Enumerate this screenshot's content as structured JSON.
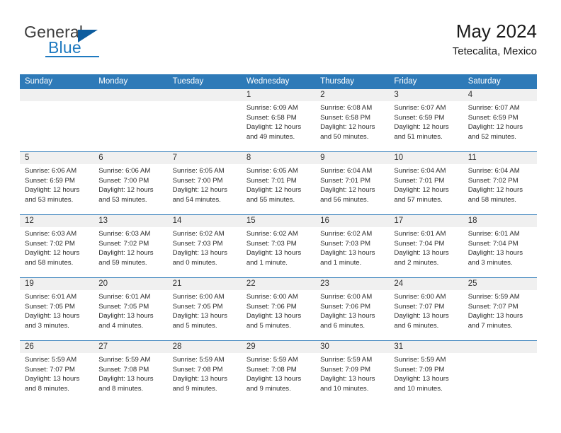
{
  "brand": {
    "word1": "General",
    "word2": "Blue",
    "logo_icon": "triangle-icon"
  },
  "header": {
    "title": "May 2024",
    "subtitle": "Tetecalita, Mexico"
  },
  "colors": {
    "header_blue": "#2e7ab8",
    "brand_blue": "#1f7ac0",
    "day_band_gray": "#f0f0f0"
  },
  "weekdays": [
    "Sunday",
    "Monday",
    "Tuesday",
    "Wednesday",
    "Thursday",
    "Friday",
    "Saturday"
  ],
  "labels": {
    "sunrise_prefix": "Sunrise:",
    "sunset_prefix": "Sunset:",
    "daylight_prefix": "Daylight:"
  },
  "weeks": [
    [
      {
        "day": "",
        "empty": true
      },
      {
        "day": "",
        "empty": true
      },
      {
        "day": "",
        "empty": true
      },
      {
        "day": "1",
        "sunrise": "Sunrise: 6:09 AM",
        "sunset": "Sunset: 6:58 PM",
        "daylight1": "Daylight: 12 hours",
        "daylight2": "and 49 minutes."
      },
      {
        "day": "2",
        "sunrise": "Sunrise: 6:08 AM",
        "sunset": "Sunset: 6:58 PM",
        "daylight1": "Daylight: 12 hours",
        "daylight2": "and 50 minutes."
      },
      {
        "day": "3",
        "sunrise": "Sunrise: 6:07 AM",
        "sunset": "Sunset: 6:59 PM",
        "daylight1": "Daylight: 12 hours",
        "daylight2": "and 51 minutes."
      },
      {
        "day": "4",
        "sunrise": "Sunrise: 6:07 AM",
        "sunset": "Sunset: 6:59 PM",
        "daylight1": "Daylight: 12 hours",
        "daylight2": "and 52 minutes."
      }
    ],
    [
      {
        "day": "5",
        "sunrise": "Sunrise: 6:06 AM",
        "sunset": "Sunset: 6:59 PM",
        "daylight1": "Daylight: 12 hours",
        "daylight2": "and 53 minutes."
      },
      {
        "day": "6",
        "sunrise": "Sunrise: 6:06 AM",
        "sunset": "Sunset: 7:00 PM",
        "daylight1": "Daylight: 12 hours",
        "daylight2": "and 53 minutes."
      },
      {
        "day": "7",
        "sunrise": "Sunrise: 6:05 AM",
        "sunset": "Sunset: 7:00 PM",
        "daylight1": "Daylight: 12 hours",
        "daylight2": "and 54 minutes."
      },
      {
        "day": "8",
        "sunrise": "Sunrise: 6:05 AM",
        "sunset": "Sunset: 7:01 PM",
        "daylight1": "Daylight: 12 hours",
        "daylight2": "and 55 minutes."
      },
      {
        "day": "9",
        "sunrise": "Sunrise: 6:04 AM",
        "sunset": "Sunset: 7:01 PM",
        "daylight1": "Daylight: 12 hours",
        "daylight2": "and 56 minutes."
      },
      {
        "day": "10",
        "sunrise": "Sunrise: 6:04 AM",
        "sunset": "Sunset: 7:01 PM",
        "daylight1": "Daylight: 12 hours",
        "daylight2": "and 57 minutes."
      },
      {
        "day": "11",
        "sunrise": "Sunrise: 6:04 AM",
        "sunset": "Sunset: 7:02 PM",
        "daylight1": "Daylight: 12 hours",
        "daylight2": "and 58 minutes."
      }
    ],
    [
      {
        "day": "12",
        "sunrise": "Sunrise: 6:03 AM",
        "sunset": "Sunset: 7:02 PM",
        "daylight1": "Daylight: 12 hours",
        "daylight2": "and 58 minutes."
      },
      {
        "day": "13",
        "sunrise": "Sunrise: 6:03 AM",
        "sunset": "Sunset: 7:02 PM",
        "daylight1": "Daylight: 12 hours",
        "daylight2": "and 59 minutes."
      },
      {
        "day": "14",
        "sunrise": "Sunrise: 6:02 AM",
        "sunset": "Sunset: 7:03 PM",
        "daylight1": "Daylight: 13 hours",
        "daylight2": "and 0 minutes."
      },
      {
        "day": "15",
        "sunrise": "Sunrise: 6:02 AM",
        "sunset": "Sunset: 7:03 PM",
        "daylight1": "Daylight: 13 hours",
        "daylight2": "and 1 minute."
      },
      {
        "day": "16",
        "sunrise": "Sunrise: 6:02 AM",
        "sunset": "Sunset: 7:03 PM",
        "daylight1": "Daylight: 13 hours",
        "daylight2": "and 1 minute."
      },
      {
        "day": "17",
        "sunrise": "Sunrise: 6:01 AM",
        "sunset": "Sunset: 7:04 PM",
        "daylight1": "Daylight: 13 hours",
        "daylight2": "and 2 minutes."
      },
      {
        "day": "18",
        "sunrise": "Sunrise: 6:01 AM",
        "sunset": "Sunset: 7:04 PM",
        "daylight1": "Daylight: 13 hours",
        "daylight2": "and 3 minutes."
      }
    ],
    [
      {
        "day": "19",
        "sunrise": "Sunrise: 6:01 AM",
        "sunset": "Sunset: 7:05 PM",
        "daylight1": "Daylight: 13 hours",
        "daylight2": "and 3 minutes."
      },
      {
        "day": "20",
        "sunrise": "Sunrise: 6:01 AM",
        "sunset": "Sunset: 7:05 PM",
        "daylight1": "Daylight: 13 hours",
        "daylight2": "and 4 minutes."
      },
      {
        "day": "21",
        "sunrise": "Sunrise: 6:00 AM",
        "sunset": "Sunset: 7:05 PM",
        "daylight1": "Daylight: 13 hours",
        "daylight2": "and 5 minutes."
      },
      {
        "day": "22",
        "sunrise": "Sunrise: 6:00 AM",
        "sunset": "Sunset: 7:06 PM",
        "daylight1": "Daylight: 13 hours",
        "daylight2": "and 5 minutes."
      },
      {
        "day": "23",
        "sunrise": "Sunrise: 6:00 AM",
        "sunset": "Sunset: 7:06 PM",
        "daylight1": "Daylight: 13 hours",
        "daylight2": "and 6 minutes."
      },
      {
        "day": "24",
        "sunrise": "Sunrise: 6:00 AM",
        "sunset": "Sunset: 7:07 PM",
        "daylight1": "Daylight: 13 hours",
        "daylight2": "and 6 minutes."
      },
      {
        "day": "25",
        "sunrise": "Sunrise: 5:59 AM",
        "sunset": "Sunset: 7:07 PM",
        "daylight1": "Daylight: 13 hours",
        "daylight2": "and 7 minutes."
      }
    ],
    [
      {
        "day": "26",
        "sunrise": "Sunrise: 5:59 AM",
        "sunset": "Sunset: 7:07 PM",
        "daylight1": "Daylight: 13 hours",
        "daylight2": "and 8 minutes."
      },
      {
        "day": "27",
        "sunrise": "Sunrise: 5:59 AM",
        "sunset": "Sunset: 7:08 PM",
        "daylight1": "Daylight: 13 hours",
        "daylight2": "and 8 minutes."
      },
      {
        "day": "28",
        "sunrise": "Sunrise: 5:59 AM",
        "sunset": "Sunset: 7:08 PM",
        "daylight1": "Daylight: 13 hours",
        "daylight2": "and 9 minutes."
      },
      {
        "day": "29",
        "sunrise": "Sunrise: 5:59 AM",
        "sunset": "Sunset: 7:08 PM",
        "daylight1": "Daylight: 13 hours",
        "daylight2": "and 9 minutes."
      },
      {
        "day": "30",
        "sunrise": "Sunrise: 5:59 AM",
        "sunset": "Sunset: 7:09 PM",
        "daylight1": "Daylight: 13 hours",
        "daylight2": "and 10 minutes."
      },
      {
        "day": "31",
        "sunrise": "Sunrise: 5:59 AM",
        "sunset": "Sunset: 7:09 PM",
        "daylight1": "Daylight: 13 hours",
        "daylight2": "and 10 minutes."
      },
      {
        "day": "",
        "empty": true,
        "blank": true
      }
    ]
  ]
}
